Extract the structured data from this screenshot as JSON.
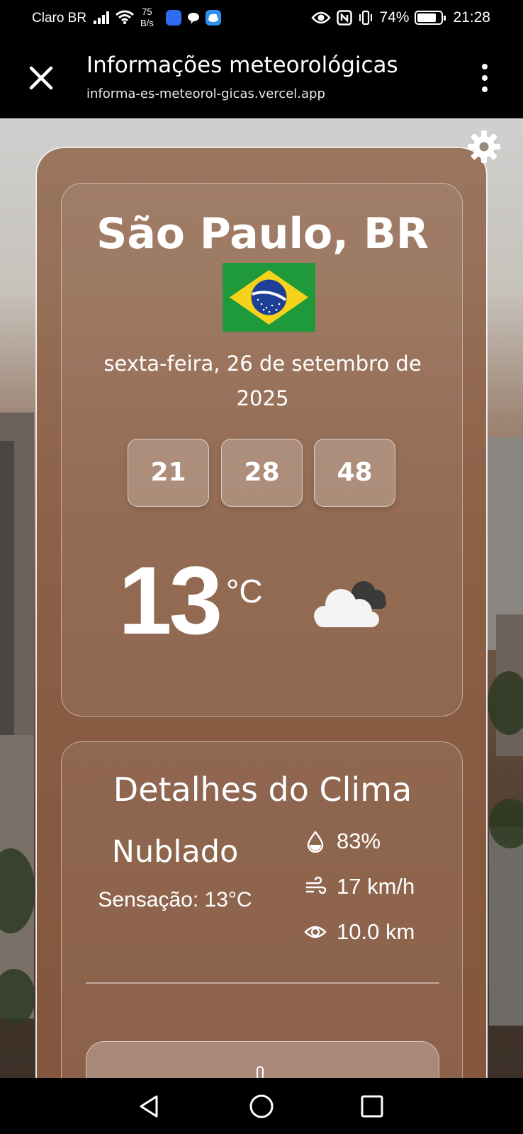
{
  "status_bar": {
    "carrier": "Claro BR",
    "speed_value": "75",
    "speed_unit": "B/s",
    "battery": "74%",
    "time": "21:28"
  },
  "browser": {
    "title": "Informações meteorológicas",
    "url": "informa-es-meteorol-gicas.vercel.app"
  },
  "weather": {
    "city": "São Paulo, BR",
    "date": "sexta-feira, 26 de setembro de 2025",
    "clock": {
      "hours": "21",
      "minutes": "28",
      "seconds": "48"
    },
    "temperature": "13",
    "unit": "°C",
    "icon": "partly-cloudy-night-icon"
  },
  "details": {
    "title": "Detalhes do Clima",
    "condition": "Nublado",
    "feels_like": "Sensação: 13°C",
    "humidity": "83%",
    "wind": "17 km/h",
    "visibility": "10.0 km"
  },
  "colors": {
    "card": "#8c6046",
    "flag_green": "#1f9a3a",
    "flag_yellow": "#f6d21a",
    "flag_blue": "#1e3f95"
  }
}
